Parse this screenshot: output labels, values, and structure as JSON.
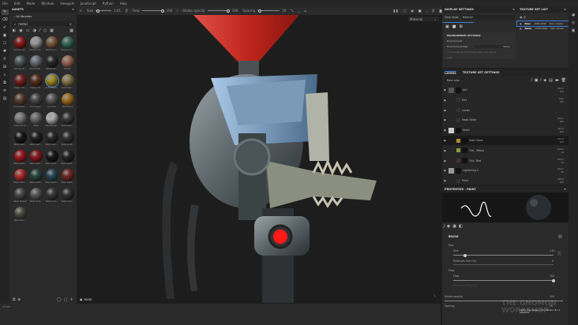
{
  "menu": [
    "File",
    "Edit",
    "Mode",
    "Window",
    "Viewport",
    "JavaScript",
    "Python",
    "Help"
  ],
  "toolbar": {
    "size_label": "Size",
    "size_value": "1.61",
    "flow_label": "Flow",
    "flow_value": "100",
    "stroke_opacity_label": "Stroke opacity",
    "stroke_opacity_value": "100",
    "spacing_label": "Spacing",
    "spacing_value": "20",
    "viewport_mode": "Material"
  },
  "assets": {
    "title": "ASSETS",
    "library": "All libraries",
    "search": "metal",
    "materials": [
      {
        "name": "Aluminium...",
        "color": "#8a1a1a"
      },
      {
        "name": "Aluminium...",
        "color": "#9a9a9a"
      },
      {
        "name": "Bronze Ar...",
        "color": "#7a5a40"
      },
      {
        "name": "Bronze Co...",
        "color": "#3a6a5a"
      },
      {
        "name": "Bronze St...",
        "color": "#4a5a58"
      },
      {
        "name": "Chrome Bl...",
        "color": "#6a7078"
      },
      {
        "name": "Cobalt Gu...",
        "color": "#2a2a2a"
      },
      {
        "name": "Copper",
        "color": "#9a6a55"
      },
      {
        "name": "Copper Ro...",
        "color": "#7a2020"
      },
      {
        "name": "Copper W...",
        "color": "#5a3020"
      },
      {
        "name": "Gold Rebuf...",
        "color": "#a08a20"
      },
      {
        "name": "Gold Dam...",
        "color": "#8a7a50"
      },
      {
        "name": "Iron Dama...",
        "color": "#5a4030"
      },
      {
        "name": "Iron Forge...",
        "color": "#4a4a4a"
      },
      {
        "name": "Iron Old",
        "color": "#5a5a5a"
      },
      {
        "name": "Machinery",
        "color": "#a07020"
      },
      {
        "name": "Silver Armor",
        "color": "#7a7a7a"
      },
      {
        "name": "Steel",
        "color": "#6a6a6a"
      },
      {
        "name": "Steel Brigh...",
        "color": "#b0b0b0"
      },
      {
        "name": "Steel Dam...",
        "color": "#3a3a3a"
      },
      {
        "name": "Steel Dark...",
        "color": "#1a1a1a"
      },
      {
        "name": "Steel Dark...",
        "color": "#222"
      },
      {
        "name": "Steel Dark...",
        "color": "#2a2a2a"
      },
      {
        "name": "Steel Matt...",
        "color": "#333"
      },
      {
        "name": "Steel Paint...",
        "color": "#a01a20"
      },
      {
        "name": "Steel Paint...",
        "color": "#8a1a20"
      },
      {
        "name": "Steel Paint...",
        "color": "#1a1a1a"
      },
      {
        "name": "Steel Paint...",
        "color": "#252525"
      },
      {
        "name": "Steel Paint...",
        "color": "#b03030"
      },
      {
        "name": "Steel Paint...",
        "color": "#2a4a40"
      },
      {
        "name": "Steel Paint...",
        "color": "#2a4a5a"
      },
      {
        "name": "Steel Paint...",
        "color": "#7a2a2a"
      },
      {
        "name": "Steel Rusted",
        "color": "#4a4a4a"
      },
      {
        "name": "Steel Rust...",
        "color": "#5a5a5a"
      },
      {
        "name": "Steel Scra...",
        "color": "#3a3a3a"
      },
      {
        "name": "Steel Scra...",
        "color": "#333"
      },
      {
        "name": "Steel Tarn...",
        "color": "#505045"
      }
    ],
    "selected_index": 10
  },
  "viewport": {
    "mask_label": "MASK",
    "fps": "28 FPS"
  },
  "display": {
    "title": "DISPLAY SETTINGS",
    "view_mode_label": "View mode",
    "view_mode": "Material",
    "env_header": "ENVIRONMENT SETTINGS",
    "env_label": "Environment",
    "env_map_label": "Environment Map",
    "env_map_value": "Niobe",
    "override_label": "Override environment map color space",
    "auto_label": "Auto"
  },
  "texture_set_list": {
    "title": "TEXTURE SET LIST",
    "sets": [
      {
        "name": "Base",
        "size": "4096x4096",
        "shader": "Main shader"
      },
      {
        "name": "Blade",
        "size": "4096x4096",
        "shader": "Main shader"
      }
    ]
  },
  "layers": {
    "tab_layers": "LAYERS",
    "tab_tss": "TEXTURE SET SETTINGS",
    "channel": "Base color",
    "rows": [
      {
        "name": "Dirt",
        "blend": "Norm",
        "opacity": "100",
        "indent": 0,
        "thumb": "#555"
      },
      {
        "name": "Dirt",
        "blend": "Lign",
        "opacity": "100",
        "indent": 1,
        "thumb": "#333"
      },
      {
        "name": "Levels",
        "blend": "",
        "opacity": "",
        "indent": 1,
        "thumb": "#333"
      },
      {
        "name": "Mask Editor",
        "blend": "Norm",
        "opacity": "100",
        "indent": 1,
        "thumb": "#333"
      },
      {
        "name": "Teeth",
        "blend": "Norm",
        "opacity": "100",
        "indent": 0,
        "thumb": "#ccc"
      },
      {
        "name": "Gold Green",
        "blend": "Norm",
        "opacity": "100",
        "indent": 1,
        "thumb": "#a89030"
      },
      {
        "name": "Tint - Yellow",
        "blend": "Norm",
        "opacity": "24",
        "indent": 1,
        "thumb": "#8a9a40"
      },
      {
        "name": "Tint - Red",
        "blend": "Norm",
        "opacity": "32",
        "indent": 1,
        "thumb": "#4a3038"
      },
      {
        "name": "Lightening 2",
        "blend": "Norm",
        "opacity": "50",
        "indent": 0,
        "thumb": "#999"
      },
      {
        "name": "Paint",
        "blend": "Norm",
        "opacity": "100",
        "indent": 1,
        "thumb": "#333"
      },
      {
        "name": "Dirt",
        "blend": "Norm",
        "opacity": "100",
        "indent": 1,
        "thumb": "#333"
      }
    ]
  },
  "properties": {
    "title": "PROPERTIES - PAINT",
    "brush_header": "BRUSH",
    "size_group": "Size",
    "size_label": "Size",
    "size_value": "1.61",
    "min_size_label": "Minimum Size (%)",
    "min_size_value": "5",
    "flow_group": "Flow",
    "flow_label": "Flow",
    "flow_value": "100",
    "min_flow_label": "Minimum Flow (%)",
    "min_flow_value": "1",
    "stroke_opacity_label": "Stroke opacity",
    "stroke_opacity_value": "100",
    "spacing_label": "Spacing",
    "spacing_value": "20",
    "size_fraction": 0.12,
    "flow_fraction": 1.0
  },
  "footer": {
    "cache": "Cache Disk Usage: 97% | Version: 8.1.1 (OpenCL)"
  },
  "watermark": "THE GNOMON WORKSHOP",
  "colors": {
    "accent": "#3a7bd5",
    "panel": "#2a2a2a",
    "viewport": "#1d1d1d",
    "light": "#c0261e"
  }
}
